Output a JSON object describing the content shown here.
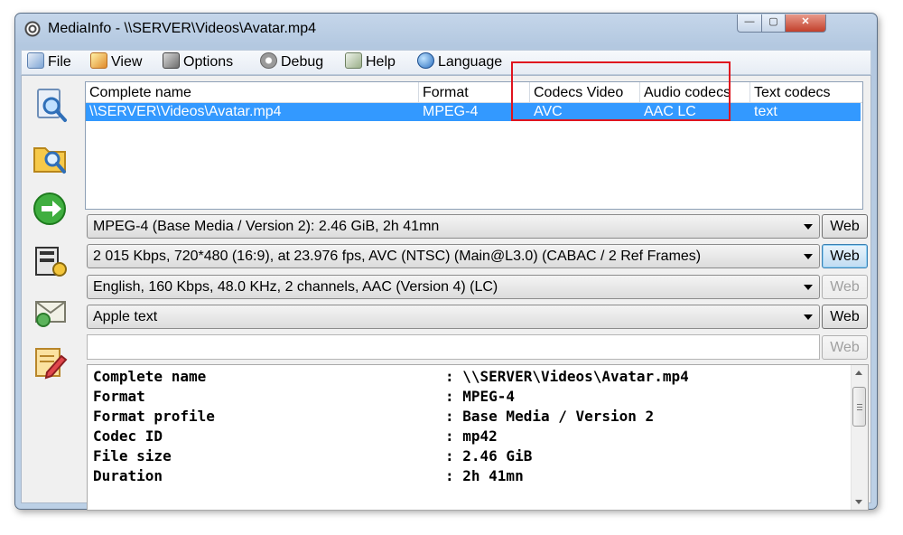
{
  "window": {
    "title": "MediaInfo - \\\\SERVER\\Videos\\Avatar.mp4"
  },
  "window_controls": {
    "minimize": "—",
    "maximize": "▢",
    "close": "✕"
  },
  "menu": [
    {
      "label": "File",
      "icon": "file-search-icon"
    },
    {
      "label": "View",
      "icon": "view-icon"
    },
    {
      "label": "Options",
      "icon": "options-icon"
    },
    {
      "label": "Debug",
      "icon": "debug-icon"
    },
    {
      "label": "Help",
      "icon": "help-icon"
    },
    {
      "label": "Language",
      "icon": "globe-icon"
    }
  ],
  "sidebar": [
    {
      "icon": "open-file-icon"
    },
    {
      "icon": "open-folder-icon"
    },
    {
      "icon": "next-arrow-icon"
    },
    {
      "icon": "export-icon"
    },
    {
      "icon": "email-icon"
    },
    {
      "icon": "edit-icon"
    }
  ],
  "list": {
    "headers": [
      "Complete name",
      "Format",
      "Codecs Video",
      "Audio codecs",
      "Text codecs"
    ],
    "rows": [
      [
        "\\\\SERVER\\Videos\\Avatar.mp4",
        "MPEG-4",
        "AVC",
        "AAC LC",
        "text"
      ]
    ]
  },
  "streams": [
    {
      "text": "MPEG-4 (Base Media / Version 2): 2.46 GiB, 2h 41mn",
      "web": "Web",
      "web_state": "normal"
    },
    {
      "text": "2 015 Kbps, 720*480 (16:9), at 23.976 fps, AVC (NTSC) (Main@L3.0) (CABAC / 2 Ref Frames)",
      "web": "Web",
      "web_state": "focused"
    },
    {
      "text": "English, 160 Kbps, 48.0 KHz, 2 channels, AAC (Version 4) (LC)",
      "web": "Web",
      "web_state": "disabled"
    },
    {
      "text": "Apple text",
      "web": "Web",
      "web_state": "normal"
    },
    {
      "text": "",
      "web": "Web",
      "web_state": "disabled"
    }
  ],
  "details": [
    {
      "field": "Complete name",
      "value": ": \\\\SERVER\\Videos\\Avatar.mp4"
    },
    {
      "field": "Format",
      "value": ": MPEG-4"
    },
    {
      "field": "Format profile",
      "value": ": Base Media / Version 2"
    },
    {
      "field": "Codec ID",
      "value": ": mp42"
    },
    {
      "field": "File size",
      "value": ": 2.46 GiB"
    },
    {
      "field": "Duration",
      "value": ": 2h 41mn"
    }
  ],
  "colors": {
    "selection": "#3399ff",
    "highlight_box": "#e0141e"
  }
}
